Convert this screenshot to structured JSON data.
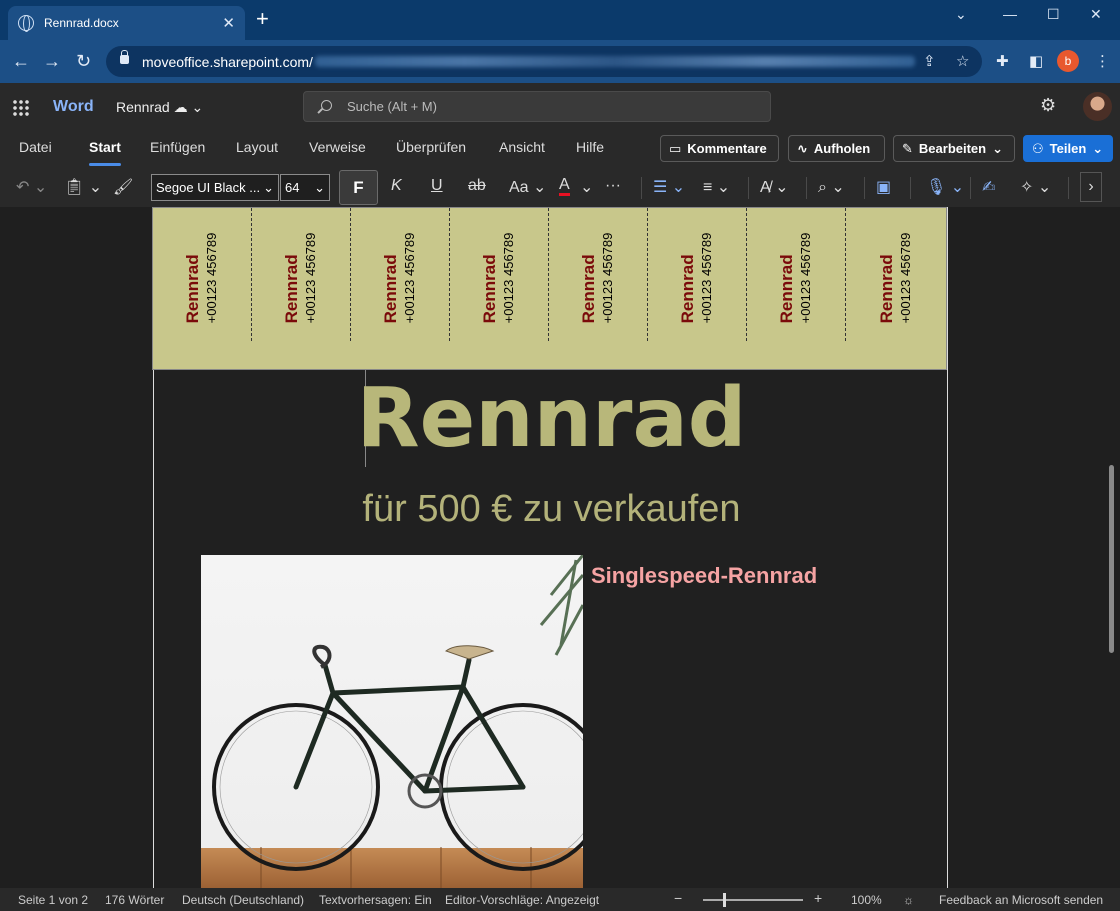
{
  "browser": {
    "tab_title": "Rennrad.docx",
    "url_host": "moveoffice.sharepoint.com/",
    "profile_initial": "b"
  },
  "word": {
    "app_name": "Word",
    "doc_name": "Rennrad",
    "search_placeholder": "Suche (Alt + M)"
  },
  "ribbon": {
    "tabs": [
      "Datei",
      "Start",
      "Einfügen",
      "Layout",
      "Verweise",
      "Überprüfen",
      "Ansicht",
      "Hilfe"
    ],
    "active_tab": "Start",
    "buttons": {
      "comments": "Kommentare",
      "catchup": "Aufholen",
      "edit": "Bearbeiten",
      "share": "Teilen"
    }
  },
  "toolbar": {
    "font_name": "Segoe UI Black ...",
    "font_size": "64",
    "bold": "F",
    "italic": "K",
    "underline": "U",
    "strike": "ab",
    "case": "Aa",
    "font_color": "A",
    "more": "···"
  },
  "document": {
    "strips": [
      {
        "title": "Rennrad",
        "phone": "+00123 456789"
      },
      {
        "title": "Rennrad",
        "phone": "+00123 456789"
      },
      {
        "title": "Rennrad",
        "phone": "+00123 456789"
      },
      {
        "title": "Rennrad",
        "phone": "+00123 456789"
      },
      {
        "title": "Rennrad",
        "phone": "+00123 456789"
      },
      {
        "title": "Rennrad",
        "phone": "+00123 456789"
      },
      {
        "title": "Rennrad",
        "phone": "+00123 456789"
      },
      {
        "title": "Rennrad",
        "phone": "+00123 456789"
      }
    ],
    "headline": "Rennrad",
    "subline": "für 500 € zu verkaufen",
    "caption": "Singlespeed-Rennrad"
  },
  "statusbar": {
    "page": "Seite 1 von 2",
    "words": "176 Wörter",
    "language": "Deutsch (Deutschland)",
    "predictions": "Textvorhersagen: Ein",
    "editor": "Editor-Vorschläge: Angezeigt",
    "zoom": "100%",
    "feedback": "Feedback an Microsoft senden"
  },
  "colors": {
    "strip_bg": "#c8c78b",
    "strip_title": "#7a0a0a",
    "headline": "#b8b77a",
    "caption": "#f5a3a3",
    "accent": "#1a6fd6"
  }
}
